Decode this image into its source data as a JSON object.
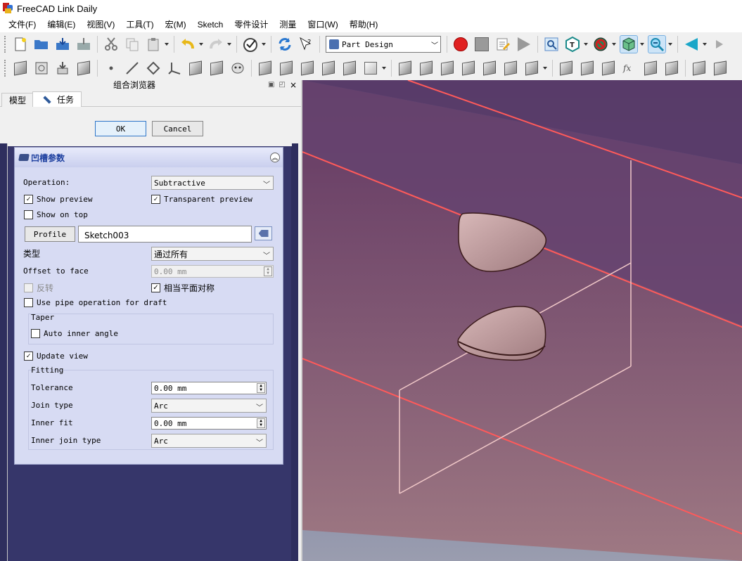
{
  "window": {
    "title": "FreeCAD Link Daily"
  },
  "menu": [
    "文件(F)",
    "编辑(E)",
    "视图(V)",
    "工具(T)",
    "宏(M)",
    "Sketch",
    "零件设计",
    "测量",
    "窗口(W)",
    "帮助(H)"
  ],
  "toolbar": {
    "workbench": "Part Design"
  },
  "combo_view": {
    "title": "组合浏览器",
    "tab_model": "模型",
    "tab_task": "任务",
    "close_glyph": "×"
  },
  "task": {
    "ok_label": "OK",
    "cancel_label": "Cancel",
    "group_title": "凹槽参数",
    "operation_label": "Operation:",
    "operation_value": "Subtractive",
    "show_preview": "Show preview",
    "transparent_preview": "Transparent preview",
    "show_on_top": "Show on top",
    "profile_button": "Profile",
    "profile_value": "Sketch003",
    "type_label": "类型",
    "type_value": "通过所有",
    "offset_label": "Offset to face",
    "offset_value": "0.00 mm",
    "reversed": "反转",
    "symmetric": "相当平面对称",
    "pipe_draft": "Use pipe operation for draft",
    "taper_title": "Taper",
    "auto_inner_angle": "Auto inner angle",
    "update_view": "Update view",
    "fitting_title": "Fitting",
    "tolerance_label": "Tolerance",
    "tolerance_value": "0.00 mm",
    "join_type_label": "Join type",
    "join_type_value": "Arc",
    "inner_fit_label": "Inner fit",
    "inner_fit_value": "0.00 mm",
    "inner_join_label": "Inner join type",
    "inner_join_value": "Arc",
    "check_glyph": "✓"
  },
  "colors": {
    "edge": "#ff5a5a",
    "face": "#8a5070",
    "shape": "#c8a0a0"
  }
}
